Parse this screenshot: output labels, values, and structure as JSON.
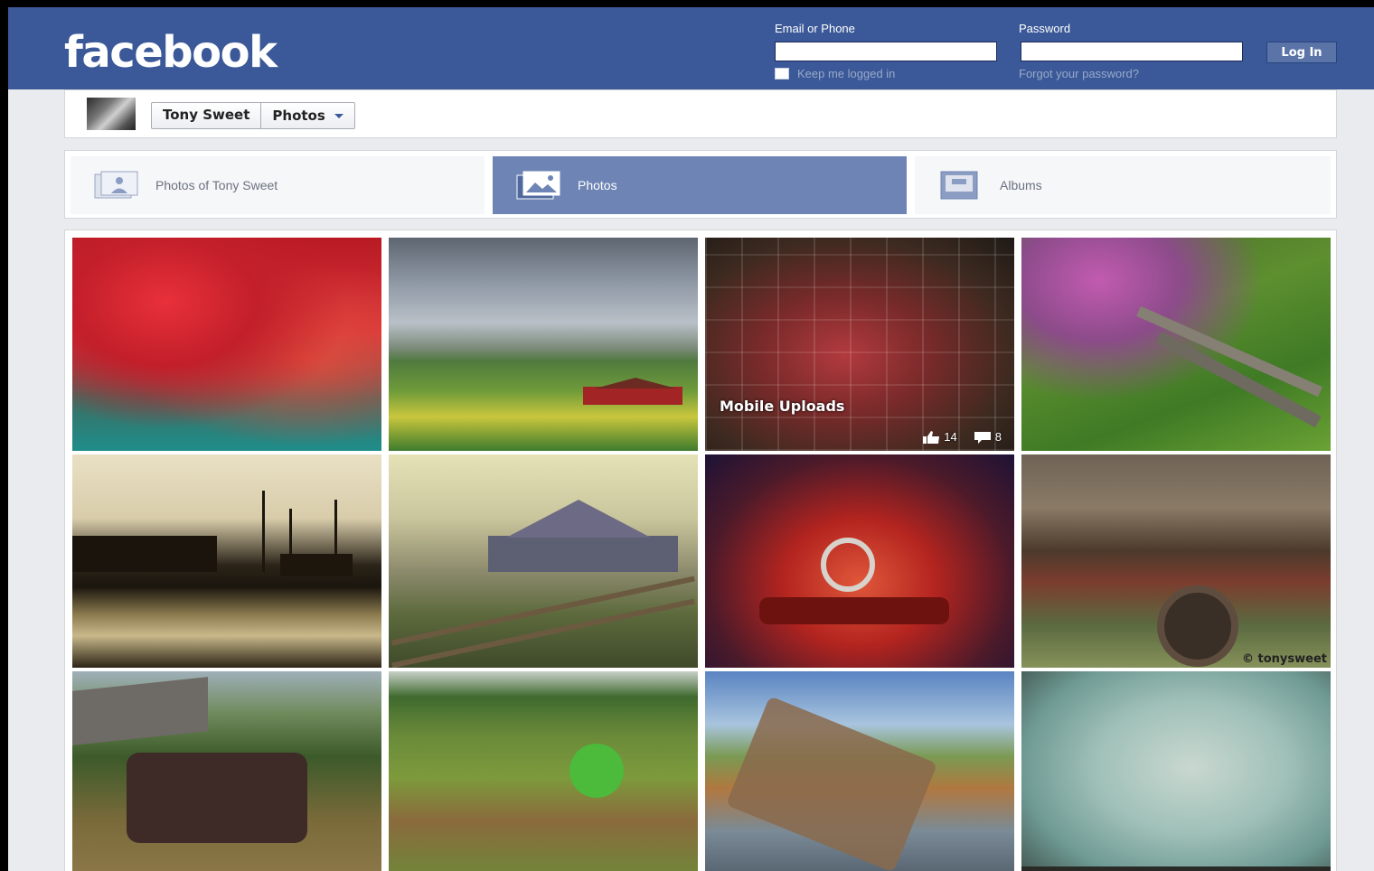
{
  "brand": "facebook",
  "login": {
    "email_label": "Email or Phone",
    "password_label": "Password",
    "login_button": "Log In",
    "keep_logged_in": "Keep me logged in",
    "forgot_password": "Forgot your password?"
  },
  "profile": {
    "name": "Tony Sweet",
    "section": "Photos"
  },
  "tabs": [
    {
      "label": "Photos of Tony Sweet",
      "active": false
    },
    {
      "label": "Photos",
      "active": true
    },
    {
      "label": "Albums",
      "active": false
    }
  ],
  "photos": [
    {
      "subject": "red foliage abstract"
    },
    {
      "subject": "farm field with red barn"
    },
    {
      "subject": "rusty truck",
      "caption": "Mobile Uploads",
      "likes": "14",
      "comments": "8"
    },
    {
      "subject": "flowers and split-rail fence"
    },
    {
      "subject": "harbor with fishing boats"
    },
    {
      "subject": "grey barn with fence"
    },
    {
      "subject": "red vintage car front"
    },
    {
      "subject": "rusty truck fender",
      "watermark": "© tonysweet"
    },
    {
      "subject": "old truck by barn"
    },
    {
      "subject": "green meadow"
    },
    {
      "subject": "rock outcrop landscape"
    },
    {
      "subject": "textured sky with birds"
    }
  ]
}
